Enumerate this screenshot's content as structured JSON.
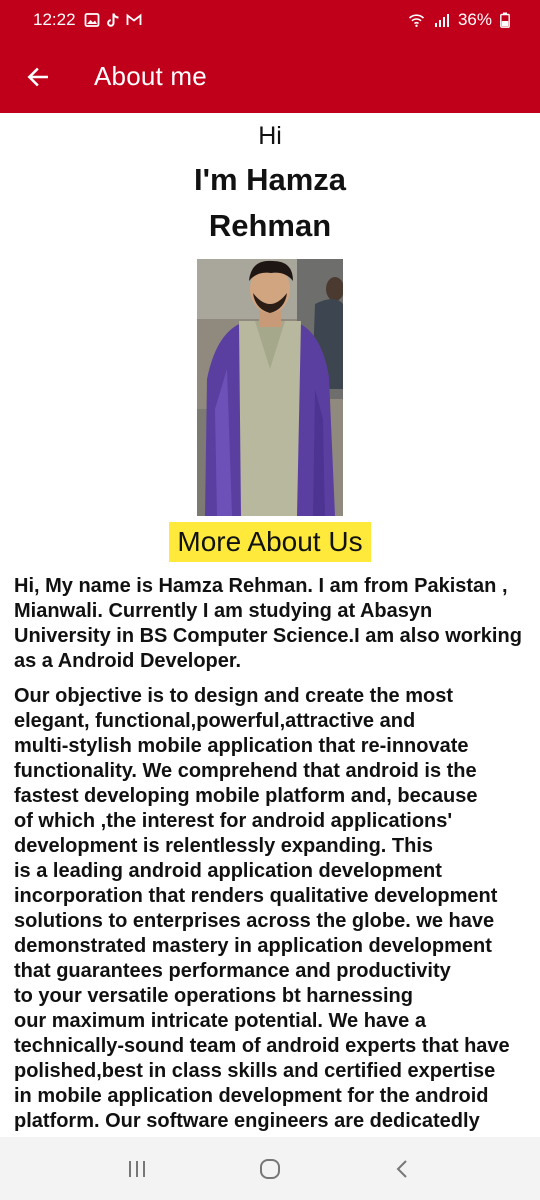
{
  "status_bar": {
    "time": "12:22",
    "battery": "36%",
    "left_icons": [
      "gallery-icon",
      "tiktok-icon",
      "gmail-icon"
    ],
    "right_icons": [
      "wifi-icon",
      "signal-icon",
      "battery-icon"
    ]
  },
  "app_bar": {
    "title": "About me",
    "back_icon": "back-arrow-icon"
  },
  "main": {
    "greeting": "Hi",
    "name": "I'm Hamza Rehman",
    "more_button": "More About Us",
    "paragraphs": [
      "Hi, My name is Hamza Rehman. I am from Pakistan ,\nMianwali. Currently I am studying at Abasyn\nUniversity in BS Computer Science.I am also working\nas a Android Developer.",
      "Our objective is to design and create the most\nelegant, functional,powerful,attractive and\nmulti-stylish mobile application that re-innovate\nfunctionality. We comprehend that android is the\nfastest developing mobile platform and, because\nof which ,the interest for android applications'\ndevelopment is relentlessly expanding. This\nis a leading android application development\nincorporation that renders qualitative development\nsolutions to enterprises across the globe. we have\ndemonstrated mastery in application development\nthat guarantees performance and productivity\nto your versatile operations bt harnessing\nour maximum intricate potential. We have a\ntechnically-sound team of android experts that have\npolished,best in class skills and certified expertise\nin mobile application development for the android\nplatform. Our software engineers are dedicatedly\nfocused on creating adaptable and powerful"
    ]
  },
  "nav_bar": {
    "items": [
      "recents-icon",
      "home-icon",
      "back-icon"
    ]
  },
  "colors": {
    "primary": "#c0001a",
    "highlight": "#ffea3b",
    "nav_background": "#f3f3f3"
  }
}
